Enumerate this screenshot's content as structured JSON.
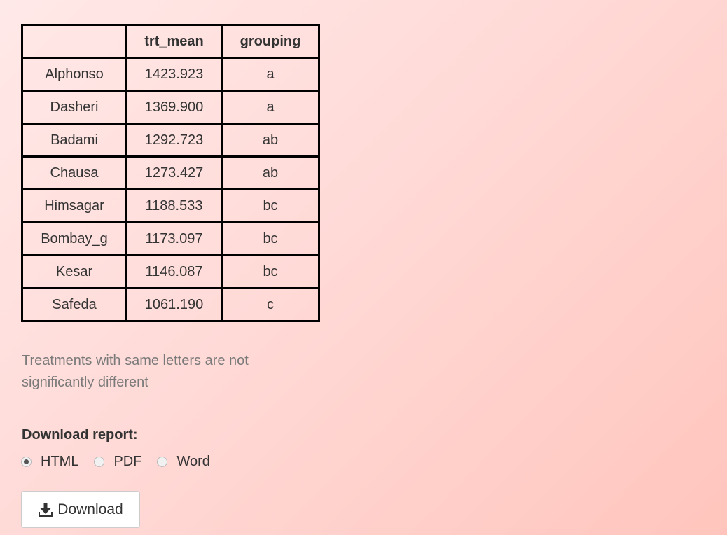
{
  "table": {
    "headers": [
      "",
      "trt_mean",
      "grouping"
    ],
    "rows": [
      [
        "Alphonso",
        "1423.923",
        "a"
      ],
      [
        "Dasheri",
        "1369.900",
        "a"
      ],
      [
        "Badami",
        "1292.723",
        "ab"
      ],
      [
        "Chausa",
        "1273.427",
        "ab"
      ],
      [
        "Himsagar",
        "1188.533",
        "bc"
      ],
      [
        "Bombay_g",
        "1173.097",
        "bc"
      ],
      [
        "Kesar",
        "1146.087",
        "bc"
      ],
      [
        "Safeda",
        "1061.190",
        "c"
      ]
    ]
  },
  "note": "Treatments with same letters are not significantly different",
  "download": {
    "label": "Download report:",
    "options": [
      "HTML",
      "PDF",
      "Word"
    ],
    "selected": "HTML",
    "button_label": "Download",
    "button_icon": "download-icon"
  }
}
